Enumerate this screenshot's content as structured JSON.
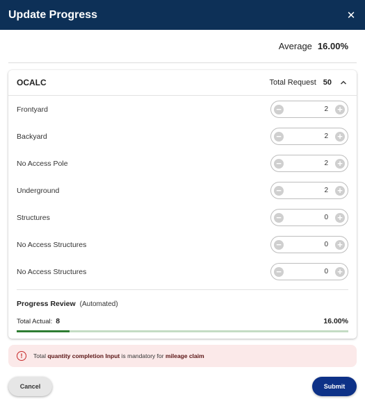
{
  "dialog": {
    "title": "Update Progress",
    "close_glyph": "✕"
  },
  "average": {
    "label": "Average",
    "value": "16.00%"
  },
  "section": {
    "name": "OCALC",
    "total_request_label": "Total Request",
    "total_request_value": "50",
    "items": [
      {
        "label": "Frontyard",
        "value": "2"
      },
      {
        "label": "Backyard",
        "value": "2"
      },
      {
        "label": "No Access Pole",
        "value": "2"
      },
      {
        "label": "Underground",
        "value": "2"
      },
      {
        "label": "Structures",
        "value": "0"
      },
      {
        "label": "No Access Structures",
        "value": "0"
      },
      {
        "label": "No Access Structures",
        "value": "0"
      }
    ]
  },
  "review": {
    "title": "Progress Review",
    "note": "(Automated)",
    "total_actual_label": "Total Actual:",
    "total_actual_value": "8",
    "percent": "16.00%",
    "progress_fraction": 0.16
  },
  "alert": {
    "prefix": "Total",
    "bold1": "quantity completion Input",
    "middle": "is mandatory for",
    "bold2": "mileage claim"
  },
  "buttons": {
    "cancel": "Cancel",
    "submit": "Submit"
  },
  "colors": {
    "header": "#0d3057",
    "submit": "#0d3187",
    "progress": "#2e7d32",
    "alert_bg": "#fbe9e9",
    "alert_icon": "#c62828"
  }
}
